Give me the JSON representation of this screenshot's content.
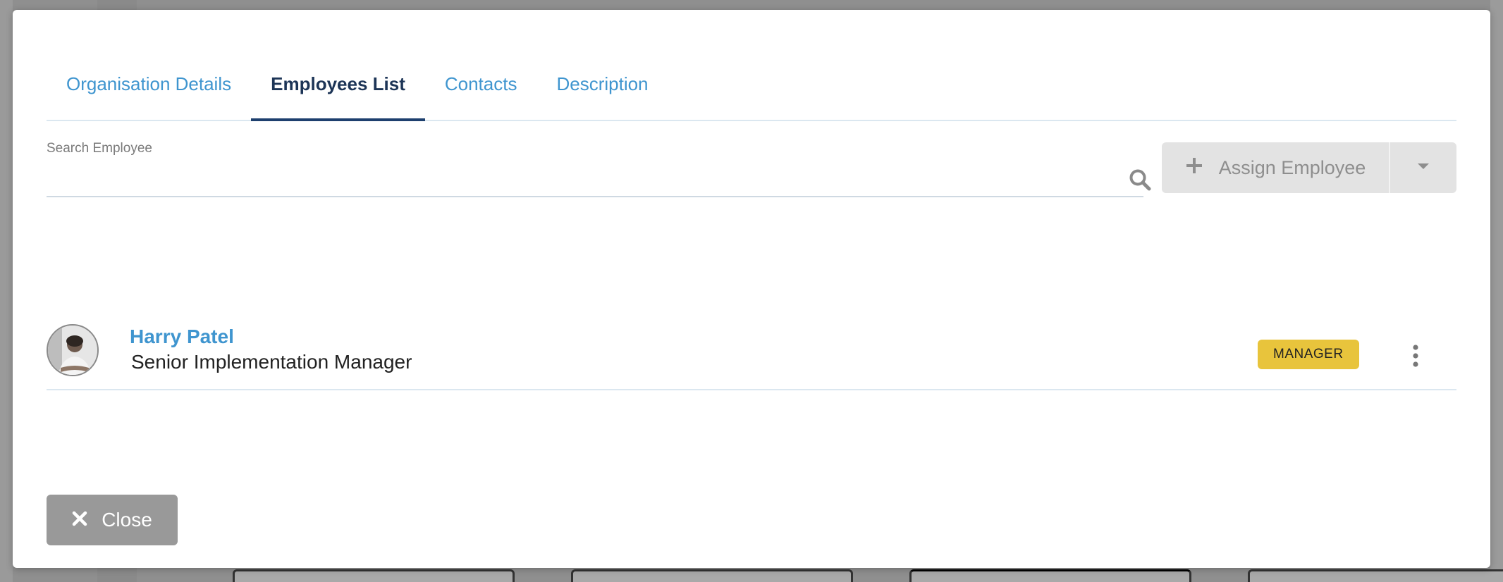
{
  "tabs": [
    {
      "label": "Organisation Details",
      "active": false
    },
    {
      "label": "Employees List",
      "active": true
    },
    {
      "label": "Contacts",
      "active": false
    },
    {
      "label": "Description",
      "active": false
    }
  ],
  "search": {
    "label": "Search Employee",
    "value": "",
    "placeholder": ""
  },
  "assign": {
    "label": "Assign Employee",
    "icon": "plus-icon",
    "dropdown_icon": "caret-down-icon"
  },
  "employees": [
    {
      "name": "Harry Patel",
      "title": "Senior Implementation Manager",
      "role_badge": "MANAGER",
      "badge_color": "#e8c43c"
    }
  ],
  "footer": {
    "close_label": "Close",
    "close_icon": "close-icon"
  },
  "colors": {
    "accent": "#3f95cf",
    "active_tab": "#1d3557",
    "button_disabled": "#e3e3e3",
    "close_button": "#999999"
  }
}
